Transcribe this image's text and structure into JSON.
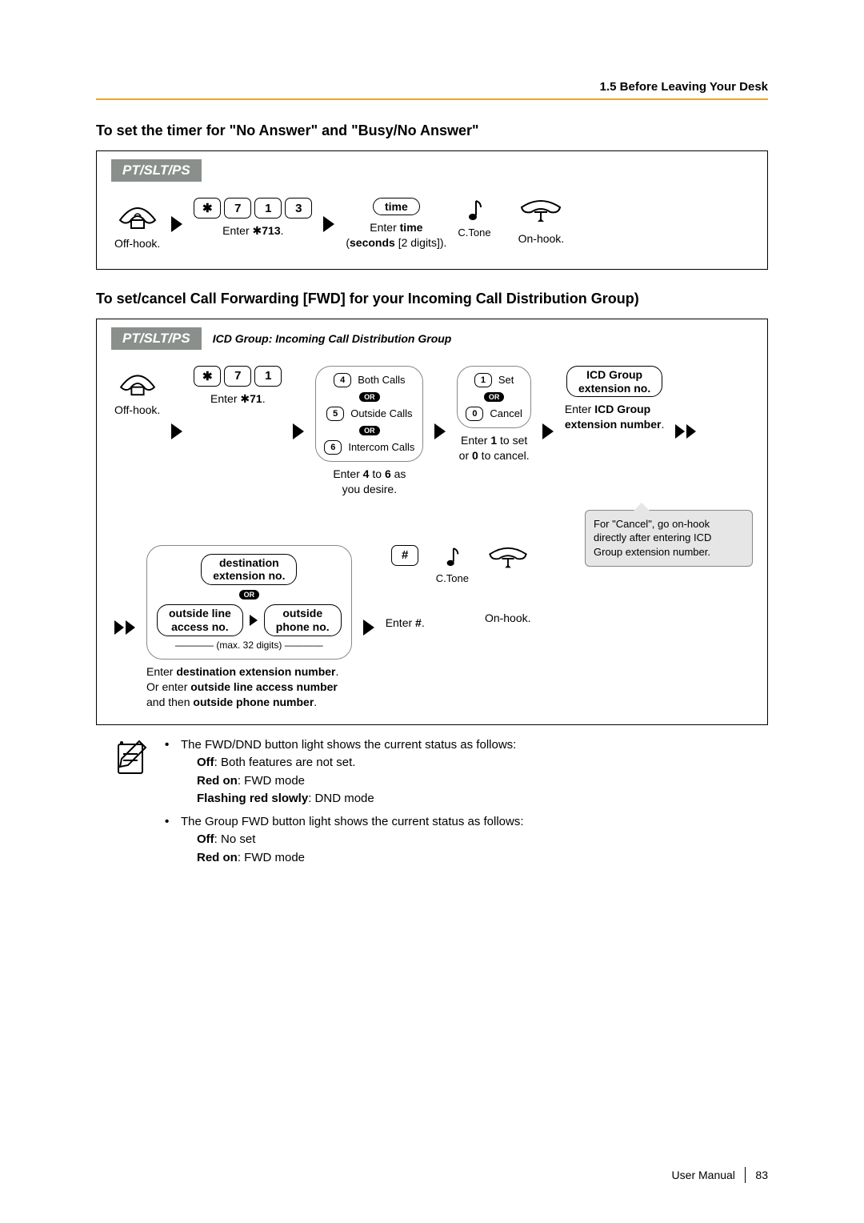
{
  "header": {
    "section": "1.5 Before Leaving Your Desk"
  },
  "heading1": "To set the timer for \"No Answer\" and \"Busy/No Answer\"",
  "heading2": "To set/cancel Call Forwarding [FWD] for your Incoming Call Distribution Group)",
  "tab": "PT/SLT/PS",
  "panel1": {
    "offhook": "Off-hook.",
    "keys": [
      "7",
      "1",
      "3"
    ],
    "enter713_pre": "Enter ",
    "enter713_code": "713",
    "enter713_post": ".",
    "time": "time",
    "entertime_pre": "Enter ",
    "entertime_b": "time",
    "entertime_line2a": "(",
    "entertime_line2b": "seconds",
    "entertime_line2c": " [2 digits]).",
    "ctone": "C.Tone",
    "onhook": "On-hook."
  },
  "panel2": {
    "tabnote": "ICD Group: Incoming Call Distribution Group",
    "offhook": "Off-hook.",
    "keys71": [
      "7",
      "1"
    ],
    "enter71_pre": "Enter ",
    "enter71_code": "71",
    "enter71_post": ".",
    "opt4": "Both Calls",
    "opt5": "Outside Calls",
    "opt6": "Intercom Calls",
    "or": "OR",
    "enter46_l1_a": "Enter ",
    "enter46_l1_b": "4",
    "enter46_l1_c": " to ",
    "enter46_l1_d": "6",
    "enter46_l1_e": " as",
    "enter46_l2": "you desire.",
    "set": "Set",
    "cancel": "Cancel",
    "enter10_l1_a": "Enter ",
    "enter10_l1_b": "1",
    "enter10_l1_c": " to set",
    "enter10_l2_a": "or ",
    "enter10_l2_b": "0",
    "enter10_l2_c": " to cancel.",
    "icd_l1": "ICD Group",
    "icd_l2": "extension no.",
    "icd_cap_a": "Enter ",
    "icd_cap_b": "ICD Group",
    "icd_cap2": "extension number",
    "callout_l1": "For \"Cancel\", go on-hook",
    "callout_l2": "directly after entering ICD",
    "callout_l3": "Group extension number.",
    "dest_l1": "destination",
    "dest_l2": "extension no.",
    "ola_l1": "outside line",
    "ola_l2": "access no.",
    "opn_l1": "outside",
    "opn_l2": "phone no.",
    "max32": "(max. 32 digits)",
    "destcap_l1_a": "Enter ",
    "destcap_l1_b": "destination extension number",
    "destcap_l1_c": ".",
    "destcap_l2_a": "Or enter ",
    "destcap_l2_b": "outside line access number",
    "destcap_l3_a": "and then ",
    "destcap_l3_b": "outside phone number",
    "destcap_l3_c": ".",
    "hash": "#",
    "enterhash_a": "Enter ",
    "enterhash_b": "#",
    "enterhash_c": ".",
    "ctone": "C.Tone",
    "onhook": "On-hook."
  },
  "notes": {
    "b1_l1": "The FWD/DND button light shows the current status as follows:",
    "b1_l2_b": "Off",
    "b1_l2_t": ": Both features are not set.",
    "b1_l3_b": "Red on",
    "b1_l3_t": ": FWD mode",
    "b1_l4_b": "Flashing red slowly",
    "b1_l4_t": ": DND mode",
    "b2_l1": "The Group FWD button light shows the current status as follows:",
    "b2_l2_b": "Off",
    "b2_l2_t": ": No set",
    "b2_l3_b": "Red on",
    "b2_l3_t": ": FWD mode"
  },
  "footer": {
    "manual": "User Manual",
    "page": "83"
  }
}
